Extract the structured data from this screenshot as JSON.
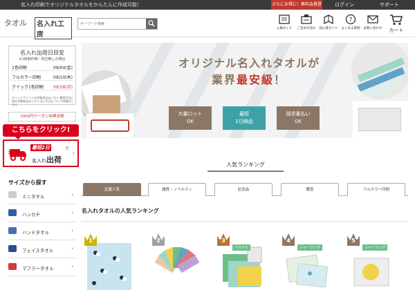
{
  "topbar": {
    "tagline": "名入れ印刷でオリジナルタオルをかんたんに作成可能！",
    "signup_label": "さらにお得に！無料会員登録",
    "login_label": "ログイン",
    "support_label": "サポート"
  },
  "header": {
    "logo_main": "タオル",
    "logo_sub": "名入れ工房",
    "search_placeholder": "キーワード検索",
    "nav": [
      {
        "label": "入稿ガイド",
        "icon": "upload-guide-icon"
      },
      {
        "label": "ご注文の流れ",
        "icon": "order-flow-icon"
      },
      {
        "label": "初心者ガイド",
        "icon": "beginner-guide-icon"
      },
      {
        "label": "よくある質問",
        "icon": "faq-icon"
      },
      {
        "label": "お問い合わせ",
        "icon": "contact-icon"
      }
    ],
    "cart_label": "カート"
  },
  "sidebar": {
    "shipping_title": "名入れ出荷日目安",
    "shipping_subtitle": "※1枚制作時・校正無しの場合",
    "shipping_rows": [
      {
        "label": "1色印刷",
        "date": "09/04(金)",
        "highlight": false
      },
      {
        "label": "フルカラー印刷",
        "date": "09/10(木)",
        "highlight": false
      },
      {
        "label": "クイック1色印刷",
        "date": "09/28(月)",
        "highlight": true
      }
    ],
    "shipping_note": "クイックプリントの対象商品はこちら 最短2日出荷の対象商品はこちら 名入れ日について詳細は",
    "shipping_note_link": "こちら",
    "coupon_label": "1000円クーポン特典多数",
    "click_label": "こちらをクリック!",
    "fast_badge": "最短2日",
    "fast_de": "で",
    "fast_text_pre": "名入れ",
    "fast_text_main": "出荷",
    "size_title": "サイズから探す",
    "size_items": [
      {
        "label": "ミニタオル",
        "color": "#cccccc"
      },
      {
        "label": "ハンカチ",
        "color": "#2f5ea8"
      },
      {
        "label": "ハンドタオル",
        "color": "#4a6fb5"
      },
      {
        "label": "フェイスタオル",
        "color": "#2a4d8f"
      },
      {
        "label": "マフラータオル",
        "color": "#d03a3a"
      }
    ]
  },
  "hero": {
    "headline_1": "オリジナル名入れタオルが",
    "headline_2_pre": "業界",
    "headline_2_red": "最安級",
    "headline_2_post": "！",
    "buttons": [
      {
        "line1": "大量ロット",
        "line2": "OK",
        "color": "#8b7766"
      },
      {
        "line1": "最短",
        "line2": "2日納品",
        "color": "#3fa1a8"
      },
      {
        "line1": "請求書払い",
        "line2": "OK",
        "color": "#8b7766"
      }
    ]
  },
  "ranking": {
    "title": "人気ランキング",
    "tabs": [
      "定番人気",
      "雑貨・ノベルティ",
      "記念品",
      "贈答",
      "フルカラー印刷"
    ],
    "active_tab": 0,
    "subtitle": "名入れタオルの人気ランキング",
    "products": [
      {
        "rank": "1",
        "badge_color": "#d4b106",
        "tag": "",
        "image_color": "#c8e4f0"
      },
      {
        "rank": "2",
        "badge_color": "#9aa3ab",
        "tag": "",
        "image_color": "#e9c9a8"
      },
      {
        "rank": "3",
        "badge_color": "#b87333",
        "tag": "パステル",
        "image_color": "#6cbf8a"
      },
      {
        "rank": "4",
        "badge_color": "#8b7766",
        "tag": "シャーリング",
        "image_color": "#e6f1e0"
      },
      {
        "rank": "5",
        "badge_color": "#8b7766",
        "tag": "シャーリング",
        "image_color": "#eeeeee"
      }
    ]
  }
}
